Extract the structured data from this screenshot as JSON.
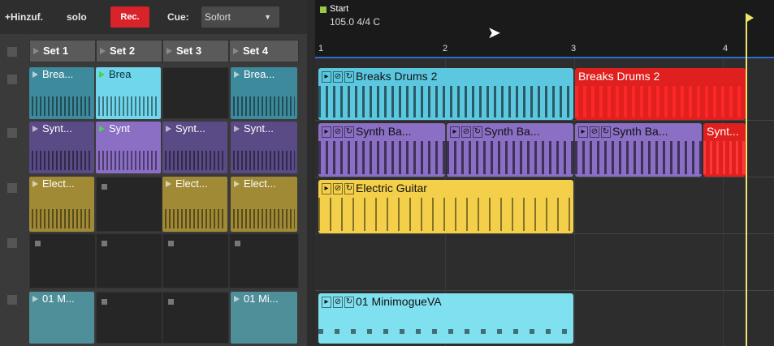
{
  "topbar": {
    "add_label": "+Hinzuf.",
    "solo_label": "solo",
    "rec_label": "Rec.",
    "cue_label": "Cue:",
    "cue_value": "Sofort"
  },
  "launcher": {
    "sets": [
      "Set 1",
      "Set 2",
      "Set 3",
      "Set 4"
    ],
    "clips": {
      "r1c1": "Brea...",
      "r1c2": "Brea",
      "r1c4": "Brea...",
      "r2c1": "Synt...",
      "r2c2": "Synt",
      "r2c3": "Synt...",
      "r2c4": "Synt...",
      "r3c1": "Elect...",
      "r3c3": "Elect...",
      "r3c4": "Elect...",
      "r5c1": "01 M...",
      "r5c4": "01 Mi..."
    }
  },
  "arranger": {
    "marker_label": "Start",
    "tempo": "105.0 4/4 C",
    "ruler_numbers": [
      "1",
      "2",
      "3",
      "4"
    ],
    "clips": {
      "drums_a": "Breaks Drums 2",
      "drums_b": "Breaks Drums 2",
      "synth_a": "Synth Ba...",
      "synth_b": "Synth Ba...",
      "synth_c": "Synth Ba...",
      "synth_d": "Synt...",
      "guitar": "Electric Guitar",
      "minimogue": "01 MinimogueVA"
    }
  },
  "colors": {
    "drums": "#5cc8e0",
    "drums_red": "#e0201e",
    "synth": "#8a6fc4",
    "guitar": "#f3cf4a",
    "minimogue": "#7fe0ef",
    "playhead": "#f0e46a"
  }
}
